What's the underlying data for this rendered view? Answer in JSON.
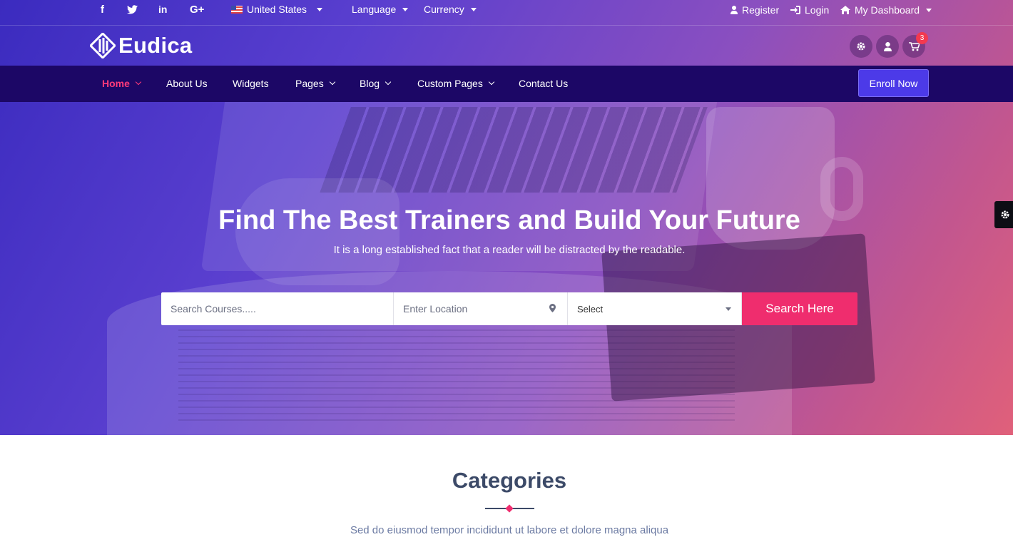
{
  "topbar": {
    "social_icons": [
      "facebook-icon",
      "twitter-icon",
      "linkedin-icon",
      "google-plus-icon"
    ],
    "country": "United States",
    "language": "Language",
    "currency": "Currency",
    "register": "Register",
    "login": "Login",
    "dashboard": "My Dashboard"
  },
  "brand": {
    "name": "Eudica",
    "cart_count": "3"
  },
  "nav": {
    "items": [
      {
        "label": "Home",
        "has_dropdown": true,
        "active": true
      },
      {
        "label": "About Us",
        "has_dropdown": false
      },
      {
        "label": "Widgets",
        "has_dropdown": false
      },
      {
        "label": "Pages",
        "has_dropdown": true
      },
      {
        "label": "Blog",
        "has_dropdown": true
      },
      {
        "label": "Custom Pages",
        "has_dropdown": true
      },
      {
        "label": "Contact Us",
        "has_dropdown": false
      }
    ],
    "enroll": "Enroll Now"
  },
  "hero": {
    "title": "Find The Best Trainers and Build Your Future",
    "subtitle": "It is a long established fact that a reader will be distracted by the readable."
  },
  "search": {
    "courses_placeholder": "Search Courses.....",
    "location_placeholder": "Enter Location",
    "select_value": "Select",
    "button": "Search Here"
  },
  "categories": {
    "title": "Categories",
    "subtitle": "Sed do eiusmod tempor incididunt ut labore et dolore magna aliqua"
  },
  "colors": {
    "nav_bg": "#1c0766",
    "accent_pink": "#ef2d6e",
    "enroll_bg": "#4c3ae8",
    "heading": "#3c4a68"
  }
}
